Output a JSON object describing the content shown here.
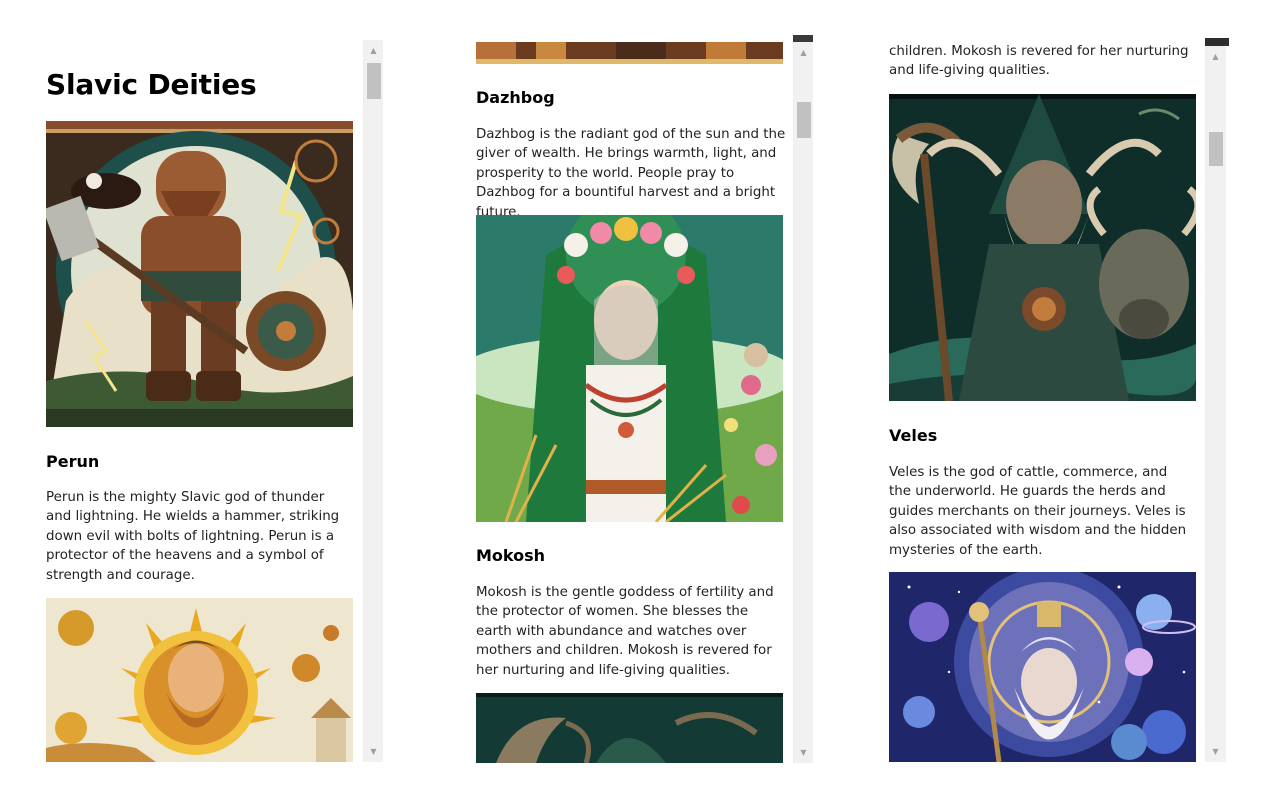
{
  "page": {
    "title": "Slavic Deities"
  },
  "deities": {
    "perun": {
      "name": "Perun",
      "description": "Perun is the mighty Slavic god of thunder and lightning. He wields a hammer, striking down evil with bolts of lightning. Perun is a protector of the heavens and a symbol of strength and courage."
    },
    "dazhbog": {
      "name": "Dazhbog",
      "description": "Dazhbog is the radiant god of the sun and the giver of wealth. He brings warmth, light, and prosperity to the world. People pray to Dazhbog for a bountiful harvest and a bright future."
    },
    "mokosh": {
      "name": "Mokosh",
      "description": "Mokosh is the gentle goddess of fertility and the protector of women. She blesses the earth with abundance and watches over mothers and children. Mokosh is revered for her nurturing and life-giving qualities.",
      "description_tail": "children. Mokosh is revered for her nurturing and life-giving qualities."
    },
    "veles": {
      "name": "Veles",
      "description": "Veles is the god of cattle, commerce, and the underworld. He guards the herds and guides merchants on their journeys. Veles is also associated with wisdom and the hidden mysteries of the earth."
    }
  },
  "icons": {
    "scroll_up": "▲",
    "scroll_down": "▼"
  },
  "colors": {
    "scrollbar_track": "#f1f1f1",
    "scrollbar_thumb": "#c1c1c1",
    "text": "#222222"
  }
}
